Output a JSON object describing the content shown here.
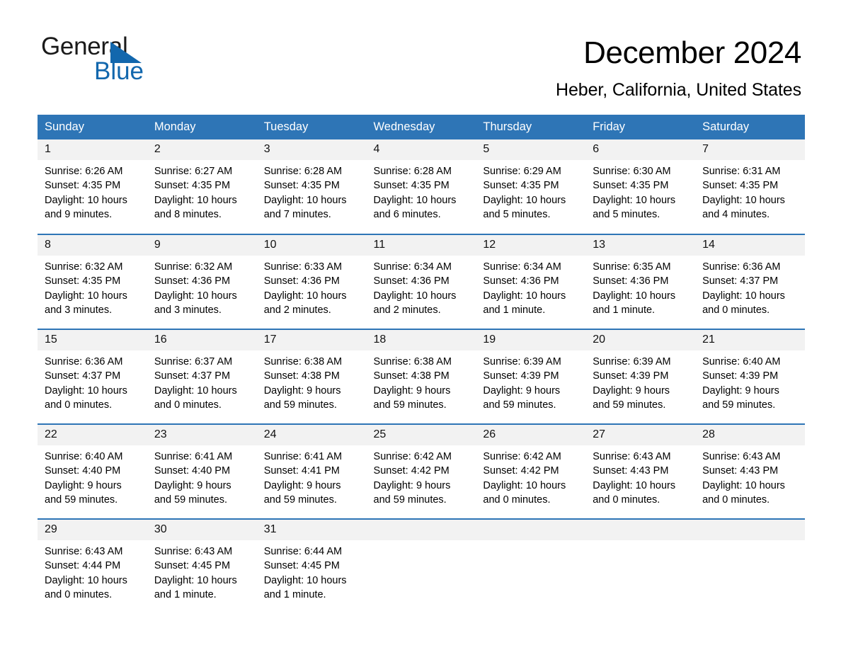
{
  "brand": {
    "name_part1": "General",
    "name_part2": "Blue",
    "triangle_color": "#1267ad",
    "logo_icon": "triangle-icon"
  },
  "header": {
    "title": "December 2024",
    "subtitle": "Heber, California, United States"
  },
  "theme": {
    "header_blue": "#2e75b6",
    "daynum_gray": "#f2f2f2",
    "text_black": "#000000"
  },
  "weekday_headers": [
    "Sunday",
    "Monday",
    "Tuesday",
    "Wednesday",
    "Thursday",
    "Friday",
    "Saturday"
  ],
  "weeks": [
    [
      {
        "day": "1",
        "sunrise": "Sunrise: 6:26 AM",
        "sunset": "Sunset: 4:35 PM",
        "daylight_line1": "Daylight: 10 hours",
        "daylight_line2": "and 9 minutes."
      },
      {
        "day": "2",
        "sunrise": "Sunrise: 6:27 AM",
        "sunset": "Sunset: 4:35 PM",
        "daylight_line1": "Daylight: 10 hours",
        "daylight_line2": "and 8 minutes."
      },
      {
        "day": "3",
        "sunrise": "Sunrise: 6:28 AM",
        "sunset": "Sunset: 4:35 PM",
        "daylight_line1": "Daylight: 10 hours",
        "daylight_line2": "and 7 minutes."
      },
      {
        "day": "4",
        "sunrise": "Sunrise: 6:28 AM",
        "sunset": "Sunset: 4:35 PM",
        "daylight_line1": "Daylight: 10 hours",
        "daylight_line2": "and 6 minutes."
      },
      {
        "day": "5",
        "sunrise": "Sunrise: 6:29 AM",
        "sunset": "Sunset: 4:35 PM",
        "daylight_line1": "Daylight: 10 hours",
        "daylight_line2": "and 5 minutes."
      },
      {
        "day": "6",
        "sunrise": "Sunrise: 6:30 AM",
        "sunset": "Sunset: 4:35 PM",
        "daylight_line1": "Daylight: 10 hours",
        "daylight_line2": "and 5 minutes."
      },
      {
        "day": "7",
        "sunrise": "Sunrise: 6:31 AM",
        "sunset": "Sunset: 4:35 PM",
        "daylight_line1": "Daylight: 10 hours",
        "daylight_line2": "and 4 minutes."
      }
    ],
    [
      {
        "day": "8",
        "sunrise": "Sunrise: 6:32 AM",
        "sunset": "Sunset: 4:35 PM",
        "daylight_line1": "Daylight: 10 hours",
        "daylight_line2": "and 3 minutes."
      },
      {
        "day": "9",
        "sunrise": "Sunrise: 6:32 AM",
        "sunset": "Sunset: 4:36 PM",
        "daylight_line1": "Daylight: 10 hours",
        "daylight_line2": "and 3 minutes."
      },
      {
        "day": "10",
        "sunrise": "Sunrise: 6:33 AM",
        "sunset": "Sunset: 4:36 PM",
        "daylight_line1": "Daylight: 10 hours",
        "daylight_line2": "and 2 minutes."
      },
      {
        "day": "11",
        "sunrise": "Sunrise: 6:34 AM",
        "sunset": "Sunset: 4:36 PM",
        "daylight_line1": "Daylight: 10 hours",
        "daylight_line2": "and 2 minutes."
      },
      {
        "day": "12",
        "sunrise": "Sunrise: 6:34 AM",
        "sunset": "Sunset: 4:36 PM",
        "daylight_line1": "Daylight: 10 hours",
        "daylight_line2": "and 1 minute."
      },
      {
        "day": "13",
        "sunrise": "Sunrise: 6:35 AM",
        "sunset": "Sunset: 4:36 PM",
        "daylight_line1": "Daylight: 10 hours",
        "daylight_line2": "and 1 minute."
      },
      {
        "day": "14",
        "sunrise": "Sunrise: 6:36 AM",
        "sunset": "Sunset: 4:37 PM",
        "daylight_line1": "Daylight: 10 hours",
        "daylight_line2": "and 0 minutes."
      }
    ],
    [
      {
        "day": "15",
        "sunrise": "Sunrise: 6:36 AM",
        "sunset": "Sunset: 4:37 PM",
        "daylight_line1": "Daylight: 10 hours",
        "daylight_line2": "and 0 minutes."
      },
      {
        "day": "16",
        "sunrise": "Sunrise: 6:37 AM",
        "sunset": "Sunset: 4:37 PM",
        "daylight_line1": "Daylight: 10 hours",
        "daylight_line2": "and 0 minutes."
      },
      {
        "day": "17",
        "sunrise": "Sunrise: 6:38 AM",
        "sunset": "Sunset: 4:38 PM",
        "daylight_line1": "Daylight: 9 hours",
        "daylight_line2": "and 59 minutes."
      },
      {
        "day": "18",
        "sunrise": "Sunrise: 6:38 AM",
        "sunset": "Sunset: 4:38 PM",
        "daylight_line1": "Daylight: 9 hours",
        "daylight_line2": "and 59 minutes."
      },
      {
        "day": "19",
        "sunrise": "Sunrise: 6:39 AM",
        "sunset": "Sunset: 4:39 PM",
        "daylight_line1": "Daylight: 9 hours",
        "daylight_line2": "and 59 minutes."
      },
      {
        "day": "20",
        "sunrise": "Sunrise: 6:39 AM",
        "sunset": "Sunset: 4:39 PM",
        "daylight_line1": "Daylight: 9 hours",
        "daylight_line2": "and 59 minutes."
      },
      {
        "day": "21",
        "sunrise": "Sunrise: 6:40 AM",
        "sunset": "Sunset: 4:39 PM",
        "daylight_line1": "Daylight: 9 hours",
        "daylight_line2": "and 59 minutes."
      }
    ],
    [
      {
        "day": "22",
        "sunrise": "Sunrise: 6:40 AM",
        "sunset": "Sunset: 4:40 PM",
        "daylight_line1": "Daylight: 9 hours",
        "daylight_line2": "and 59 minutes."
      },
      {
        "day": "23",
        "sunrise": "Sunrise: 6:41 AM",
        "sunset": "Sunset: 4:40 PM",
        "daylight_line1": "Daylight: 9 hours",
        "daylight_line2": "and 59 minutes."
      },
      {
        "day": "24",
        "sunrise": "Sunrise: 6:41 AM",
        "sunset": "Sunset: 4:41 PM",
        "daylight_line1": "Daylight: 9 hours",
        "daylight_line2": "and 59 minutes."
      },
      {
        "day": "25",
        "sunrise": "Sunrise: 6:42 AM",
        "sunset": "Sunset: 4:42 PM",
        "daylight_line1": "Daylight: 9 hours",
        "daylight_line2": "and 59 minutes."
      },
      {
        "day": "26",
        "sunrise": "Sunrise: 6:42 AM",
        "sunset": "Sunset: 4:42 PM",
        "daylight_line1": "Daylight: 10 hours",
        "daylight_line2": "and 0 minutes."
      },
      {
        "day": "27",
        "sunrise": "Sunrise: 6:43 AM",
        "sunset": "Sunset: 4:43 PM",
        "daylight_line1": "Daylight: 10 hours",
        "daylight_line2": "and 0 minutes."
      },
      {
        "day": "28",
        "sunrise": "Sunrise: 6:43 AM",
        "sunset": "Sunset: 4:43 PM",
        "daylight_line1": "Daylight: 10 hours",
        "daylight_line2": "and 0 minutes."
      }
    ],
    [
      {
        "day": "29",
        "sunrise": "Sunrise: 6:43 AM",
        "sunset": "Sunset: 4:44 PM",
        "daylight_line1": "Daylight: 10 hours",
        "daylight_line2": "and 0 minutes."
      },
      {
        "day": "30",
        "sunrise": "Sunrise: 6:43 AM",
        "sunset": "Sunset: 4:45 PM",
        "daylight_line1": "Daylight: 10 hours",
        "daylight_line2": "and 1 minute."
      },
      {
        "day": "31",
        "sunrise": "Sunrise: 6:44 AM",
        "sunset": "Sunset: 4:45 PM",
        "daylight_line1": "Daylight: 10 hours",
        "daylight_line2": "and 1 minute."
      },
      {
        "day": "",
        "sunrise": "",
        "sunset": "",
        "daylight_line1": "",
        "daylight_line2": ""
      },
      {
        "day": "",
        "sunrise": "",
        "sunset": "",
        "daylight_line1": "",
        "daylight_line2": ""
      },
      {
        "day": "",
        "sunrise": "",
        "sunset": "",
        "daylight_line1": "",
        "daylight_line2": ""
      },
      {
        "day": "",
        "sunrise": "",
        "sunset": "",
        "daylight_line1": "",
        "daylight_line2": ""
      }
    ]
  ]
}
